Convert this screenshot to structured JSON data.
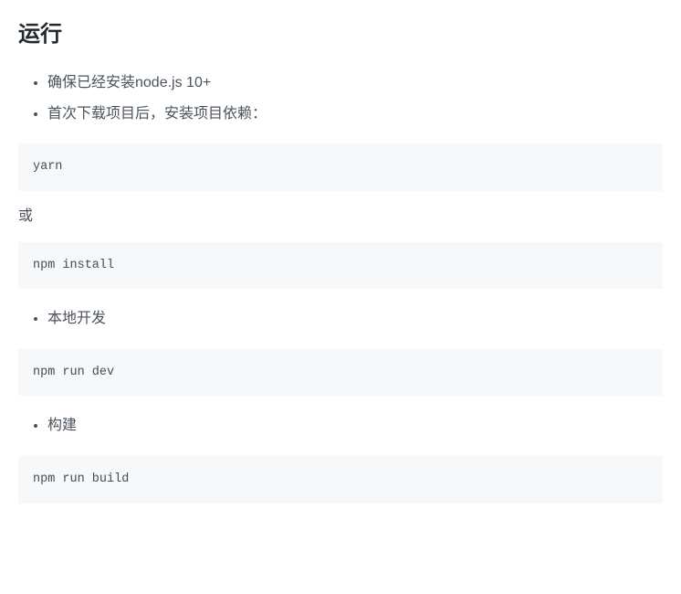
{
  "heading": "运行",
  "list1": {
    "item1": "确保已经安装node.js 10+",
    "item2": "首次下载项目后，安装项目依赖："
  },
  "code1": "yarn",
  "or_text": "或",
  "code2": "npm install",
  "list2": {
    "item1": "本地开发"
  },
  "code3": "npm run dev",
  "list3": {
    "item1": "构建"
  },
  "code4": "npm run build"
}
